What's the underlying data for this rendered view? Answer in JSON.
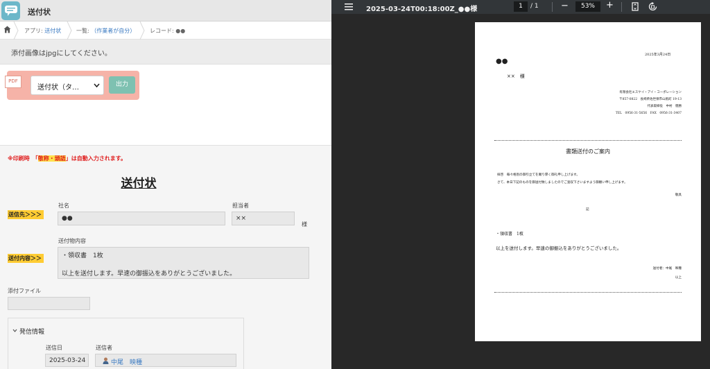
{
  "app": {
    "title": "送付状",
    "breadcrumbs": [
      {
        "prefix": "アプリ: ",
        "link": "送付状"
      },
      {
        "prefix": "一覧: ",
        "link": "（作業者が自分）"
      },
      {
        "prefix": "レコード: ",
        "link": "●●"
      }
    ],
    "notice": "添付画像はjpgにしてください。",
    "print": {
      "pdf_badge": "PDF",
      "selected_template": "送付状（タ…",
      "output_button": "出力"
    },
    "red_note": {
      "before": "※印刷時　「",
      "highlight": "敬称・頭語",
      "after": "」は自動入力されます。"
    },
    "heading": "送付状",
    "recipient": {
      "tag": "送信先＞＞＞",
      "company_label": "社名",
      "company_value": "●●",
      "person_label": "担当者",
      "person_value": "××",
      "honorific": "様"
    },
    "contents": {
      "tag": "送付内容＞＞",
      "label": "送付物内容",
      "line1": "・領収書　1枚",
      "line2": "以上を送付します。早速の御振込をありがとうございました。"
    },
    "attachment": {
      "label": "添付ファイル",
      "value": ""
    },
    "sender_section": {
      "title": "発信情報",
      "date_label": "送信日",
      "date_value": "2025-03-24",
      "sender_label": "送信者",
      "sender_value": "中尾　映種"
    }
  },
  "viewer": {
    "file_title": "2025-03-24T00:18:00Z_●●様",
    "current_page": "1",
    "total_pages": "/  1",
    "zoom": "53%",
    "minus_glyph": "−",
    "plus_glyph": "+"
  },
  "pdf": {
    "date": "2025年3月24日",
    "to_company": "●●",
    "to_person": "××　様",
    "sender": [
      "有限会社エスケイ・アイ・コーポレーション",
      "〒857-0822　長崎県佐世保市山祇町 19-13",
      "代表取締役　中村　徳勝",
      "TEL　0956-31-5656　FAX　0956-31-3407"
    ],
    "subject": "書類送付のご案内",
    "body": [
      "拝啓　毎々格別の御引立てを賜り厚く御礼申し上げます。",
      "さて、本日下記のものを御送付致しましたのでご査収下さいますよう御願い申し上げます。"
    ],
    "closing": "敬具",
    "ki": "記",
    "item": "・領収書　1枚",
    "message": "以上を送付します。早速の御振込をありがとうございました。",
    "signoff": "送付者：中尾　映種",
    "ijo": "以上"
  },
  "colors": {
    "accent_teal": "#7ec1b1",
    "print_box": "#f6b3a8",
    "tag_yellow": "#ffcc33",
    "note_red": "#e02020",
    "link_blue": "#3a7ac2",
    "viewer_bg": "#282828"
  },
  "icons": [
    "chat-bubble-icon",
    "home-icon",
    "chevron-down-icon",
    "user-icon",
    "menu-icon",
    "fit-page-icon",
    "rotate-icon"
  ]
}
